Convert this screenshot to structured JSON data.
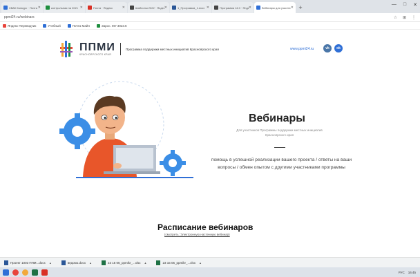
{
  "browser": {
    "tabs": [
      {
        "label": "СВАК Конкурс · Почта",
        "color": "#2f6fd6"
      },
      {
        "label": "контрольная на 2021",
        "color": "#1e8e3e"
      },
      {
        "label": "Почта · Яндекс",
        "color": "#d93025"
      },
      {
        "label": "Шаблоны 2022 · Яндекс",
        "color": "#444444"
      },
      {
        "label": "1_Программа_1.docx",
        "color": "#2b5797"
      },
      {
        "label": "Программа 14.0 · Яндекс",
        "color": "#444444"
      },
      {
        "label": "Вебинары для участник",
        "color": "#2f6fd6",
        "active": true
      }
    ],
    "new_tab": "+",
    "window_controls": [
      "—",
      "□",
      "✕"
    ],
    "url": "ppmi24.ru/webinars",
    "bookmarks": [
      {
        "label": "Яндекс Переводчик",
        "color": "#e8453c"
      },
      {
        "label": "Учебный",
        "color": "#2f6fd6"
      },
      {
        "label": "Почта Майл",
        "color": "#2f6fd6"
      },
      {
        "label": "Зарос. МУ 3023.К",
        "color": "#1e8e3e"
      }
    ]
  },
  "header": {
    "logo_title": "ППМИ",
    "logo_subtitle": "КРАСНОЯРСКОГО КРАЯ",
    "program_name": "Программа поддержки местных инициатив Красноярского края",
    "site_link": "www.ppmi24.ru",
    "social": [
      {
        "label": "vk",
        "color": "#4a76a8"
      },
      {
        "label": "ok",
        "color": "#2f6fd6"
      }
    ]
  },
  "hero": {
    "title": "Вебинары",
    "subtitle": "Для участников Программы поддержки местных инициатив Красноярского края",
    "description": "помощь в успешной реализации вашего проекта / ответы на ваши вопросы / обмен опытом с другими участниками программы"
  },
  "schedule": {
    "title": "Расписание вебинаров",
    "link": "(смотреть: Электронную настенную вебинар)"
  },
  "downloads": [
    {
      "label": "Проект 1003 ППМ...docx"
    },
    {
      "label": "ведомо.docx"
    },
    {
      "label": "23 15 05_ppmikr_...xlsx"
    },
    {
      "label": "23 15 05_ppmikr_...xlsx"
    }
  ],
  "taskbar": {
    "tray_lang": "РУС",
    "tray_time": "16:45"
  }
}
